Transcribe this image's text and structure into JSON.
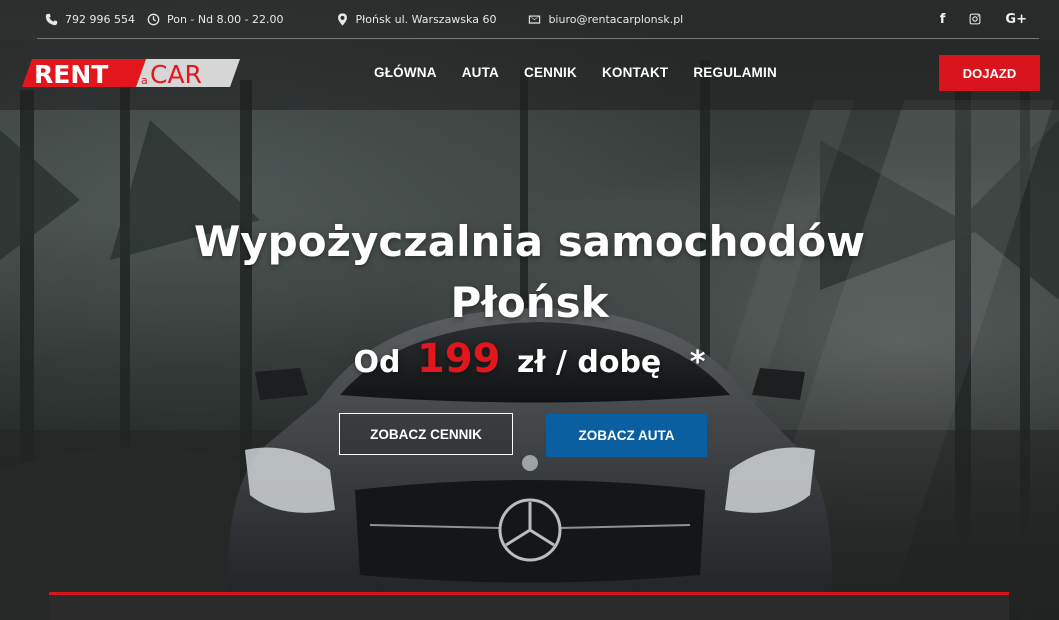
{
  "topbar": {
    "phone": "792 996 554",
    "hours": "Pon - Nd 8.00 - 22.00",
    "address": "Płońsk ul. Warszawska 60",
    "email": "biuro@rentacarplonsk.pl",
    "social": [
      {
        "icon": "facebook-icon",
        "label": "f"
      },
      {
        "icon": "instagram-icon",
        "label": ""
      },
      {
        "icon": "google-plus-icon",
        "label": "G+"
      }
    ]
  },
  "logo": {
    "rent": "RENT",
    "a": "a",
    "car": "CAR"
  },
  "nav": {
    "items": [
      "GŁÓWNA",
      "AUTA",
      "CENNIK",
      "KONTAKT",
      "REGULAMIN"
    ],
    "cta": "DOJAZD"
  },
  "hero": {
    "title_line1": "Wypożyczalnia samochodów",
    "title_line2": "Płońsk",
    "price_prefix": "Od",
    "price_amount": "199",
    "price_suffix": "zł / dobę",
    "price_star": "*",
    "button_pricing": "ZOBACZ CENNIK",
    "button_cars": "ZOBACZ AUTA"
  },
  "colors": {
    "accent_red": "#d9141c",
    "accent_blue": "#0a5fa0"
  }
}
